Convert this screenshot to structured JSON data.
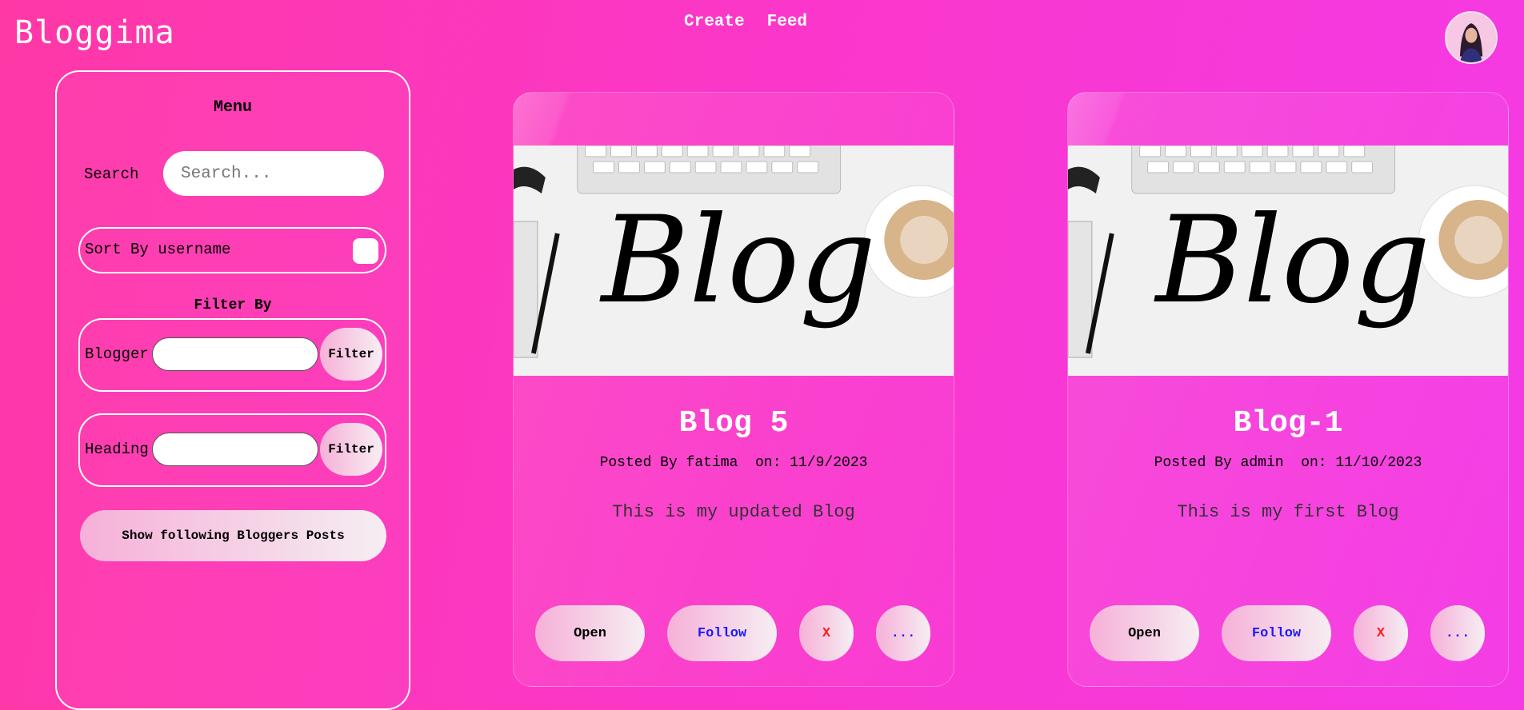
{
  "app": {
    "title": "Bloggima"
  },
  "nav": {
    "create": "Create",
    "feed": "Feed"
  },
  "sidebar": {
    "menu_title": "Menu",
    "search_label": "Search",
    "search_placeholder": "Search...",
    "sort_label": "Sort By username",
    "filter_title": "Filter By",
    "blogger_label": "Blogger",
    "heading_label": "Heading",
    "filter_button": "Filter",
    "following_button": "Show following Bloggers Posts"
  },
  "posts": [
    {
      "title": "Blog 5",
      "meta": "Posted By fatima  on: 11/9/2023",
      "body": "This is my updated Blog",
      "actions": {
        "open": "Open",
        "follow": "Follow",
        "delete": "X",
        "more": "..."
      }
    },
    {
      "title": "Blog-1",
      "meta": "Posted By admin  on: 11/10/2023",
      "body": "This is my first Blog",
      "actions": {
        "open": "Open",
        "follow": "Follow",
        "delete": "X",
        "more": "..."
      }
    }
  ],
  "image_text": "Blog",
  "colors": {
    "accent": "#f43ae6",
    "follow_text": "#1a1aff",
    "delete_text": "#ff1a1a"
  },
  "icons": {
    "avatar": "user-avatar",
    "card_image": "blog-cover-image"
  }
}
